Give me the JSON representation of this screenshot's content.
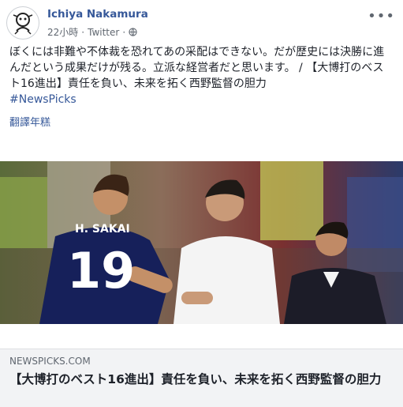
{
  "post": {
    "author": "Ichiya Nakamura",
    "time": "22小時",
    "separator": "·",
    "source": "Twitter",
    "more_icon": "more-icon",
    "text": {
      "line1": "ぼくには非難や不体裁を恐れてあの采配はできない。だが歴史には決勝に進んだという成果だけが残る。立派な経営者だと思います。 / 【大博打のベスト16進出】責任を負い、未来を拓く西野監督の胆力",
      "hashtag": "#NewsPicks"
    },
    "translate_label": "翻譯年糕"
  },
  "photo": {
    "jersey_name": "H. SAKAI",
    "jersey_number": "19"
  },
  "link": {
    "domain": "NEWSPICKS.COM",
    "title": "【大博打のベスト16進出】責任を負い、未来を拓く西野監督の胆力"
  },
  "colors": {
    "link_blue": "#365899",
    "secondary_text": "#606770",
    "box_bg": "#f2f3f5"
  }
}
